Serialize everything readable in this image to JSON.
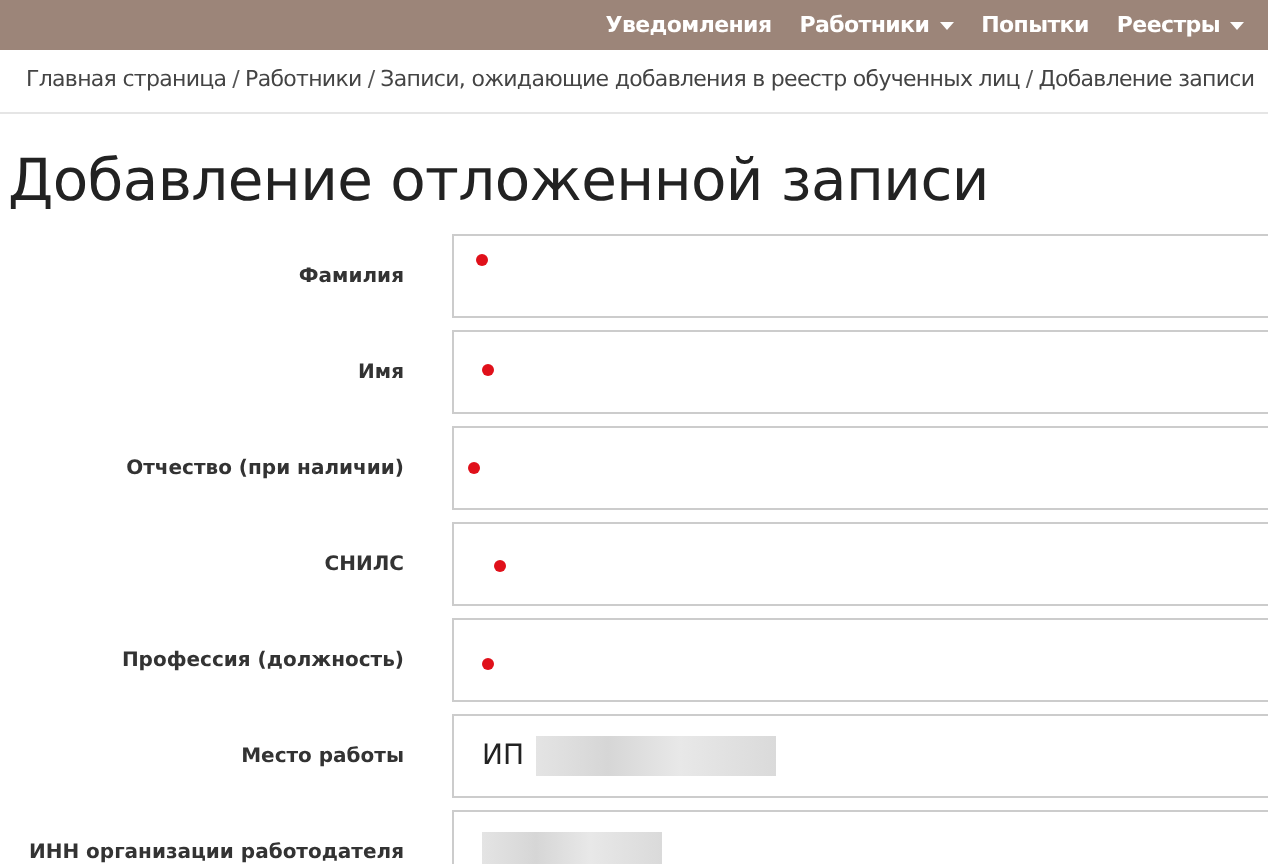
{
  "nav": [
    {
      "label": "Уведомления",
      "dropdown": false
    },
    {
      "label": "Работники",
      "dropdown": true
    },
    {
      "label": "Попытки",
      "dropdown": false
    },
    {
      "label": "Реестры",
      "dropdown": true
    }
  ],
  "breadcrumb": [
    {
      "kind": "link",
      "label": "Главная страница"
    },
    {
      "kind": "separator",
      "label": "/"
    },
    {
      "kind": "text",
      "label": "Работники"
    },
    {
      "kind": "separator",
      "label": "/"
    },
    {
      "kind": "link",
      "label": "Записи, ожидающие добавления в реестр обученных лиц"
    },
    {
      "kind": "separator",
      "label": "/"
    },
    {
      "kind": "text",
      "label": "Добавление записи"
    }
  ],
  "title": "Добавление отложенной записи",
  "fields": [
    {
      "label": "Фамилия",
      "marker": true,
      "redacted": false
    },
    {
      "label": "Имя",
      "marker": true,
      "redacted": false
    },
    {
      "label": "Отчество (при наличии)",
      "marker": true,
      "redacted": false
    },
    {
      "label": "СНИЛС",
      "marker": true,
      "redacted": false
    },
    {
      "label": "Профессия (должность)",
      "marker": true,
      "redacted": false
    },
    {
      "label": "Место работы",
      "value": "ИП",
      "marker": false,
      "redacted": true
    },
    {
      "label": "ИНН организации работодателя",
      "marker": false,
      "redacted": true
    }
  ]
}
